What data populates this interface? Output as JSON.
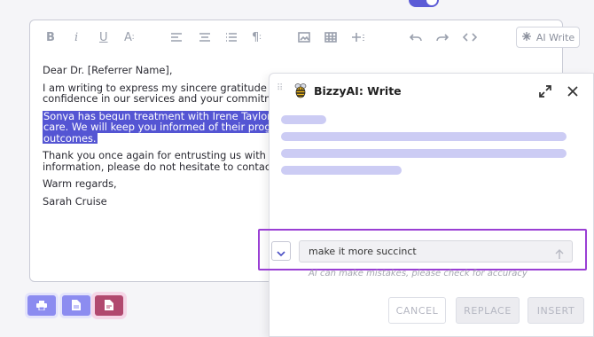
{
  "editor": {
    "toolbar": {
      "ai_write_label": "AI Write"
    },
    "letter": {
      "greeting": "Dear Dr. [Referrer Name],",
      "para1_line1": "I am writing to express my sincere gratitude for refer",
      "para1_line2": "confidence in our services and your commitment to e",
      "para2_line1": "Sonya has begun treatment with Irene Taylor, and we",
      "para2_line2": "care. We will keep you informed of their progress and",
      "para2_line3": "outcomes.",
      "para3_line1": "Thank you once again for entrusting us with Sonya's c",
      "para3_line2": "information, please do not hesitate to contact us.",
      "closing": "Warm regards,",
      "signature": "Sarah Cruise"
    }
  },
  "ai_panel": {
    "title": "BizzyAI: Write",
    "prompt_value": "make it more succinct",
    "disclaimer": "AI can make mistakes, please check for accuracy",
    "cancel_label": "CANCEL",
    "replace_label": "REPLACE",
    "insert_label": "INSERT"
  },
  "colors": {
    "highlight": "#5455d3",
    "accent": "#8c8cf0",
    "pdf": "#b1496f",
    "prompt_border": "#9a3fd4"
  }
}
